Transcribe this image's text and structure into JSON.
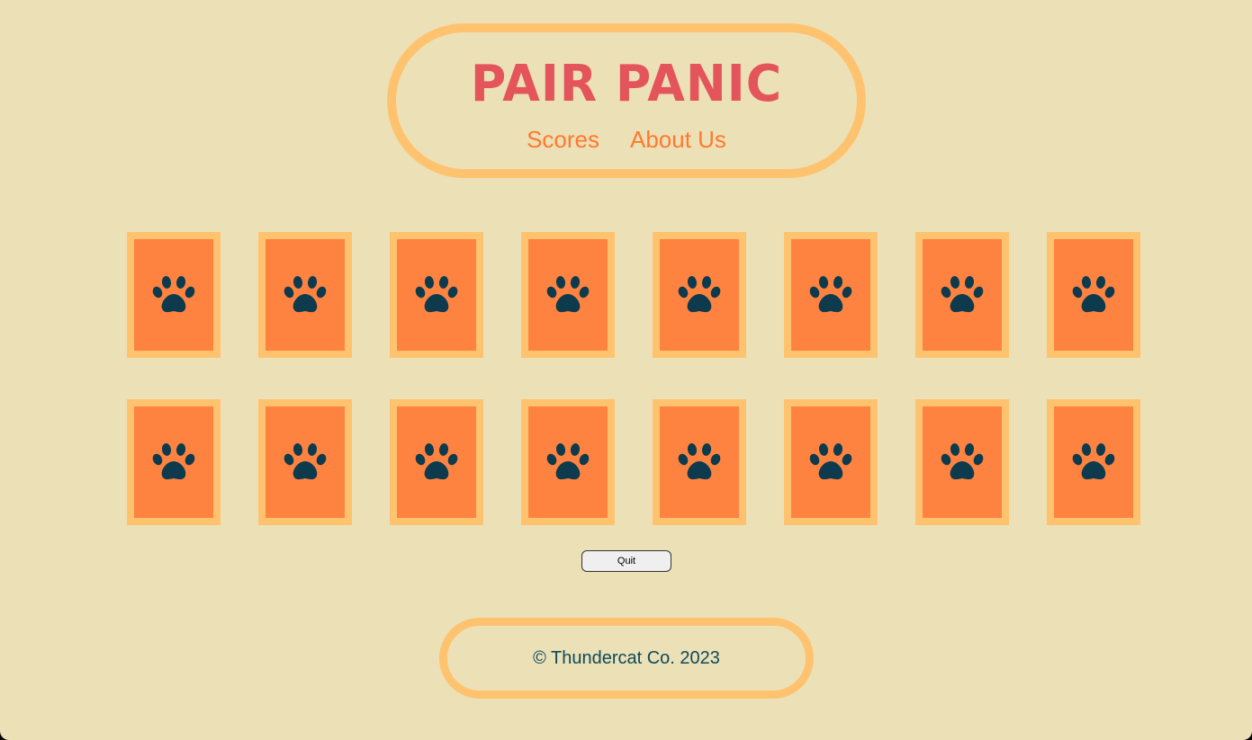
{
  "header": {
    "title": "PAIR PANIC",
    "nav": [
      "Scores",
      "About Us"
    ]
  },
  "board": {
    "card_icon": "paw-icon",
    "rows": [
      [
        "card-back",
        "card-back",
        "card-back",
        "card-back",
        "card-back",
        "card-back",
        "card-back",
        "card-back"
      ],
      [
        "card-back",
        "card-back",
        "card-back",
        "card-back",
        "card-back",
        "card-back",
        "card-back",
        "card-back"
      ]
    ]
  },
  "controls": {
    "quit_label": "Quit"
  },
  "footer": {
    "text": "© Thundercat Co. 2023"
  },
  "colors": {
    "background": "#ECE0B7",
    "frame": "#FFC36F",
    "title": "#E4555B",
    "nav_link": "#FF7A2F",
    "card": "#FF8340",
    "paw": "#0D3B4D",
    "footer_text": "#0E4A5A"
  }
}
